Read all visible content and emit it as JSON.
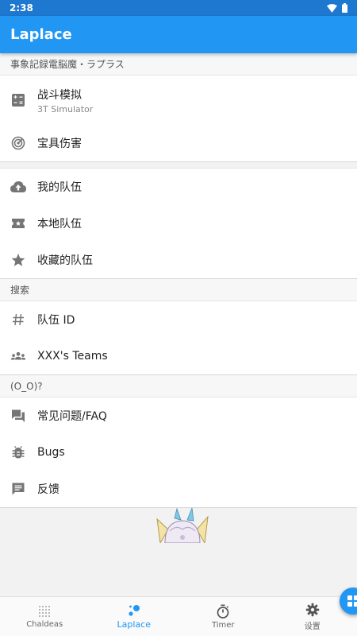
{
  "status_bar": {
    "time": "2:38"
  },
  "app_bar": {
    "title": "Laplace"
  },
  "sections": {
    "main_header": "事象記録電脳魔・ラプラス",
    "simulator": {
      "title": "战斗模拟",
      "subtitle": "3T Simulator"
    },
    "np_damage": "宝具伤害",
    "my_teams": "我的队伍",
    "local_teams": "本地队伍",
    "fav_teams": "收藏的队伍",
    "search_header": "搜索",
    "team_id": "队伍 ID",
    "user_teams": "XXX's Teams",
    "misc_header": "(O_O)?",
    "faq": "常见问题/FAQ",
    "bugs": "Bugs",
    "feedback": "反馈"
  },
  "bottom_nav": {
    "chaldeas": "Chaldeas",
    "laplace": "Laplace",
    "timer": "Timer",
    "settings": "设置"
  },
  "colors": {
    "primary": "#2196f3",
    "status_bar": "#1e78cf",
    "icon_gray": "#757575"
  }
}
